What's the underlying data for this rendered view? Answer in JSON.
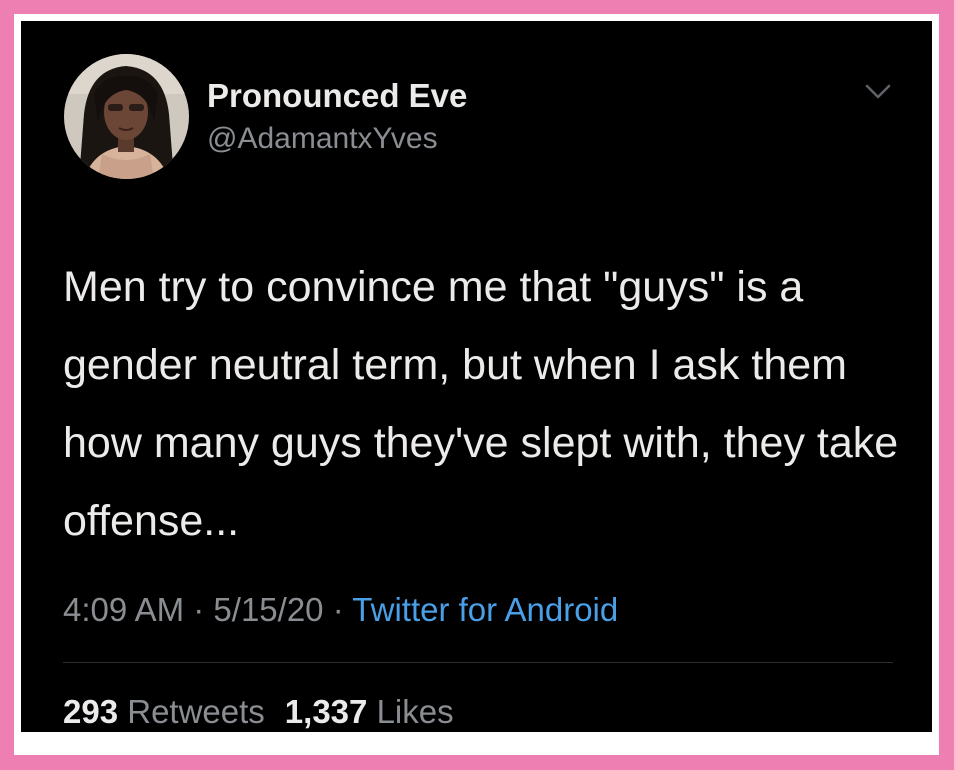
{
  "author": {
    "display_name": "Pronounced Eve",
    "handle": "@AdamantxYves"
  },
  "tweet": {
    "text": "Men try to convince me that \"guys\" is a gender neutral term, but when I ask them how many guys they've slept with, they take offense...",
    "time": "4:09 AM",
    "date": "5/15/20",
    "separator": "·",
    "source": "Twitter for Android"
  },
  "stats": {
    "retweets_count": "293",
    "retweets_label": "Retweets",
    "likes_count": "1,337",
    "likes_label": "Likes"
  },
  "icons": {
    "menu": "chevron-down-icon"
  },
  "colors": {
    "frame_border": "#ee7fb3",
    "background": "#000000",
    "text": "#ecebea",
    "secondary_text": "#8a8d91",
    "link": "#4a9fe6"
  }
}
